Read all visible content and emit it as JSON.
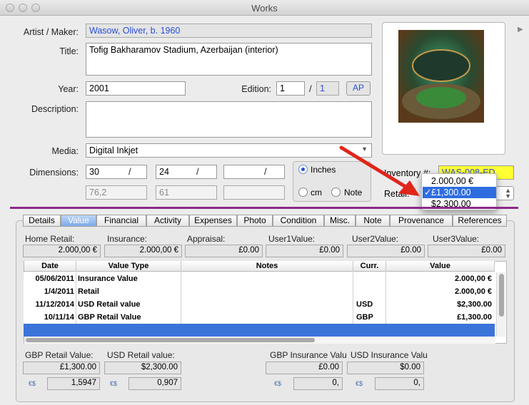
{
  "window": {
    "title": "Works"
  },
  "form": {
    "artist_label": "Artist / Maker:",
    "artist_value": "Wasow, Oliver, b. 1960",
    "title_label": "Title:",
    "title_value": "Tofig Bakharamov Stadium, Azerbaijan (interior)",
    "year_label": "Year:",
    "year_value": "2001",
    "edition_label": "Edition:",
    "edition_value": "1",
    "edition_of": "1",
    "edition_slash": "/",
    "ap_label": "AP",
    "description_label": "Description:",
    "description_value": "",
    "media_label": "Media:",
    "media_value": "Digital Inkjet",
    "dimensions_label": "Dimensions:",
    "dim_in": [
      "30",
      "24",
      ""
    ],
    "dim_cm": [
      "76,2",
      "61",
      ""
    ],
    "dim_slash": "/",
    "unit_inches": "Inches",
    "unit_cm": "cm",
    "unit_note": "Note",
    "inventory_label": "Inventory #:",
    "inventory_value": "WAS-008-ED",
    "retail_label": "Retail:"
  },
  "retail_menu": {
    "items": [
      "2.000,00 €",
      "£1,300.00",
      "$2,300.00"
    ],
    "selected_check": "✓"
  },
  "tabs": [
    "Details",
    "Value",
    "Financial",
    "Activity",
    "Expenses",
    "Photo",
    "Condition",
    "Misc.",
    "Note",
    "Provenance",
    "References"
  ],
  "value_tab": {
    "summary_labels": [
      "Home Retail:",
      "Insurance:",
      "Appraisal:",
      "User1Value:",
      "User2Value:",
      "User3Value:"
    ],
    "summary_values": [
      "2.000,00 €",
      "2.000,00 €",
      "£0.00",
      "£0.00",
      "£0.00",
      "£0.00"
    ],
    "table": {
      "headers": [
        "Date",
        "Value Type",
        "Notes",
        "Curr.",
        "Value"
      ],
      "rows": [
        [
          "05/06/2011",
          "Insurance Value",
          "",
          "",
          "2.000,00 €"
        ],
        [
          "1/4/2011",
          "Retail",
          "",
          "",
          "2.000,00 €"
        ],
        [
          "11/12/2014",
          "USD Retail value",
          "",
          "USD",
          "$2,300.00"
        ],
        [
          "10/11/14",
          "GBP Retail Value",
          "",
          "GBP",
          "£1,300.00"
        ]
      ]
    },
    "bottom_labels": [
      "GBP Retail Value:",
      "USD Retail value:",
      "GBP Insurance Valu",
      "USD Insurance Valu"
    ],
    "bottom_values": [
      "£1,300.00",
      "$2,300.00",
      "£0.00",
      "$0.00"
    ],
    "rate_values": [
      "1,5947",
      "0,907",
      "0,",
      "0,"
    ],
    "rate_icon": "€$"
  },
  "colors": {
    "accent": "#2e6de0",
    "divider": "#8a2a8a",
    "inventory_bg": "#ffff33",
    "arrow": "#e0251b"
  }
}
